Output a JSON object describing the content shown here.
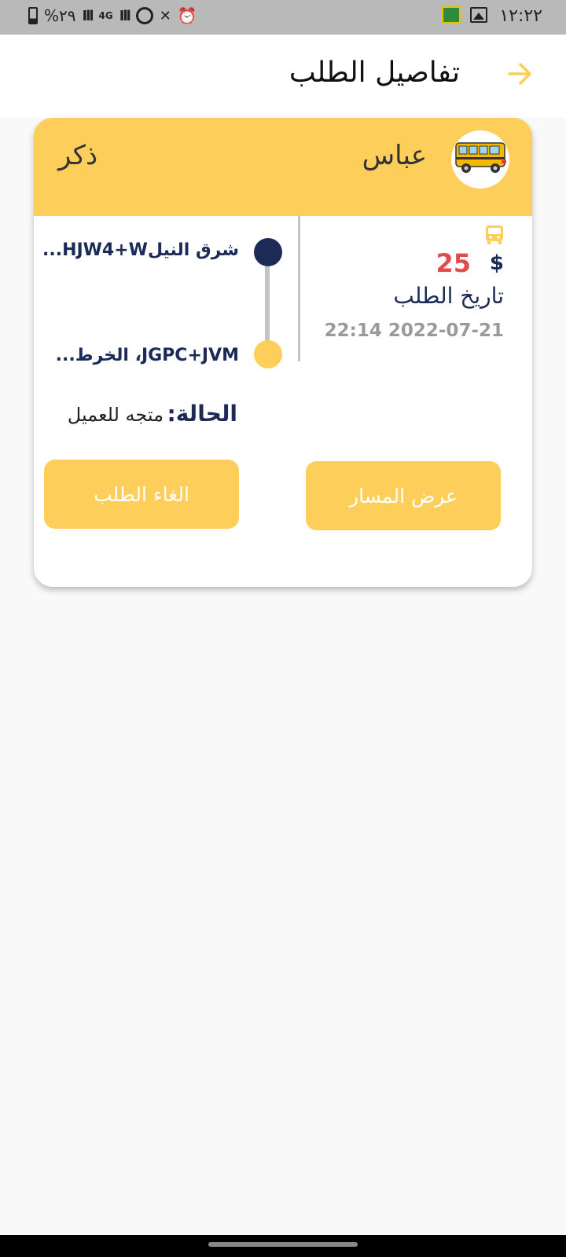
{
  "status_bar": {
    "time": "١٢:٢٢",
    "battery": "%٢٩",
    "network": "4G",
    "icons": [
      "book-app-icon",
      "image-icon",
      "alarm-icon",
      "mute-vibrate-icon",
      "hotspot-icon",
      "signal-icon",
      "battery-icon"
    ]
  },
  "header": {
    "title": "تفاصيل الطلب",
    "back_icon": "arrow-right-icon"
  },
  "order": {
    "driver_name": "عباس",
    "gender": "ذكر",
    "avatar_icon": "school-bus-icon",
    "from_address": "شرق النيلHJW4+W...",
    "to_address": "JGPC+JVM، الخرط...",
    "currency_symbol": "$",
    "price": "25",
    "date_label": "تاريخ الطلب",
    "date_value": "22:14 2022-07-21",
    "status_label": "الحالة:",
    "status_value": "متجه للعميل",
    "route_button": "عرض المسار",
    "cancel_button": "الغاء الطلب"
  },
  "colors": {
    "accent": "#fece5a",
    "navy": "#1c2a58",
    "price": "#e34b4b",
    "muted": "#9a9a9a"
  }
}
